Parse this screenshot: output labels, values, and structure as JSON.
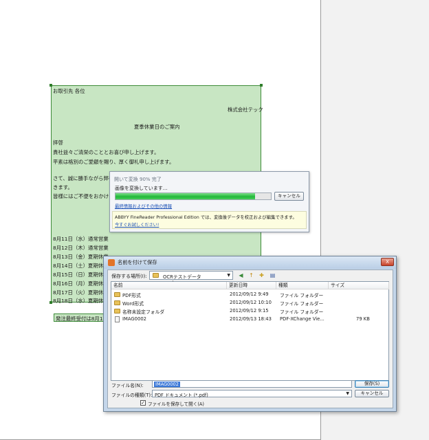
{
  "document": {
    "lines": [
      "お取引先 各位",
      "株式会社テック",
      "夏季休業日のご案内",
      "拝啓",
      "貴社益々ご清栄のこととお喜び申し上げます。",
      "平素は格別のご愛顧を賜り、厚く御礼申し上げます。",
      "さて、誠に勝手ながら弊社",
      "きます。",
      "皆様にはご不便をおかけい",
      "8月11日（水）通常営業",
      "8月12日（木）通常営業",
      "8月13日（金）夏期休業",
      "8月14日（土）夏期休業",
      "8月15日（日）夏期休業",
      "8月16日（月）夏期休業",
      "8月17日（火）夏期休業",
      "8月18日（水）夏期休業"
    ],
    "footer_line": "発注最終受付は8月11"
  },
  "progress_dialog": {
    "title": "開いて変換 90% 完了",
    "status": "画像を変換しています...",
    "progress": 0.9,
    "cancel_label": "キャンセル",
    "link": "最終情報およびその他の情報",
    "info_text": "ABBYY FineReader Professional Edition では、変換後データを校正および編集できます。",
    "info_link": "今すぐお試しください!"
  },
  "save_dialog": {
    "title": "名前を付けて保存",
    "close_label": "X",
    "location_label": "保存する場所(I):",
    "location_value": "OCRテストデータ",
    "columns": [
      "名前",
      "更新日時",
      "種類",
      "サイズ"
    ],
    "files": [
      {
        "name": "PDF形式",
        "date": "2012/09/12 9:49",
        "type": "ファイル フォルダー",
        "size": "",
        "icon": "folder"
      },
      {
        "name": "Word形式",
        "date": "2012/09/12 10:10",
        "type": "ファイル フォルダー",
        "size": "",
        "icon": "folder"
      },
      {
        "name": "名称未設定フォルダ",
        "date": "2012/09/12 9:15",
        "type": "ファイル フォルダー",
        "size": "",
        "icon": "folder"
      },
      {
        "name": "IMAG0002",
        "date": "2012/09/13 18:43",
        "type": "PDF-XChange Vie...",
        "size": "79 KB",
        "icon": "file"
      }
    ],
    "filename_label": "ファイル名(N):",
    "filename_value": "IMAG0002",
    "filetype_label": "ファイルの種類(T):",
    "filetype_value": "PDF ドキュメント (*.pdf)",
    "save_label": "保存(S)",
    "cancel_label": "キャンセル",
    "open_after_label": "ファイルを保存して開く(A)",
    "open_after_checked": true
  }
}
